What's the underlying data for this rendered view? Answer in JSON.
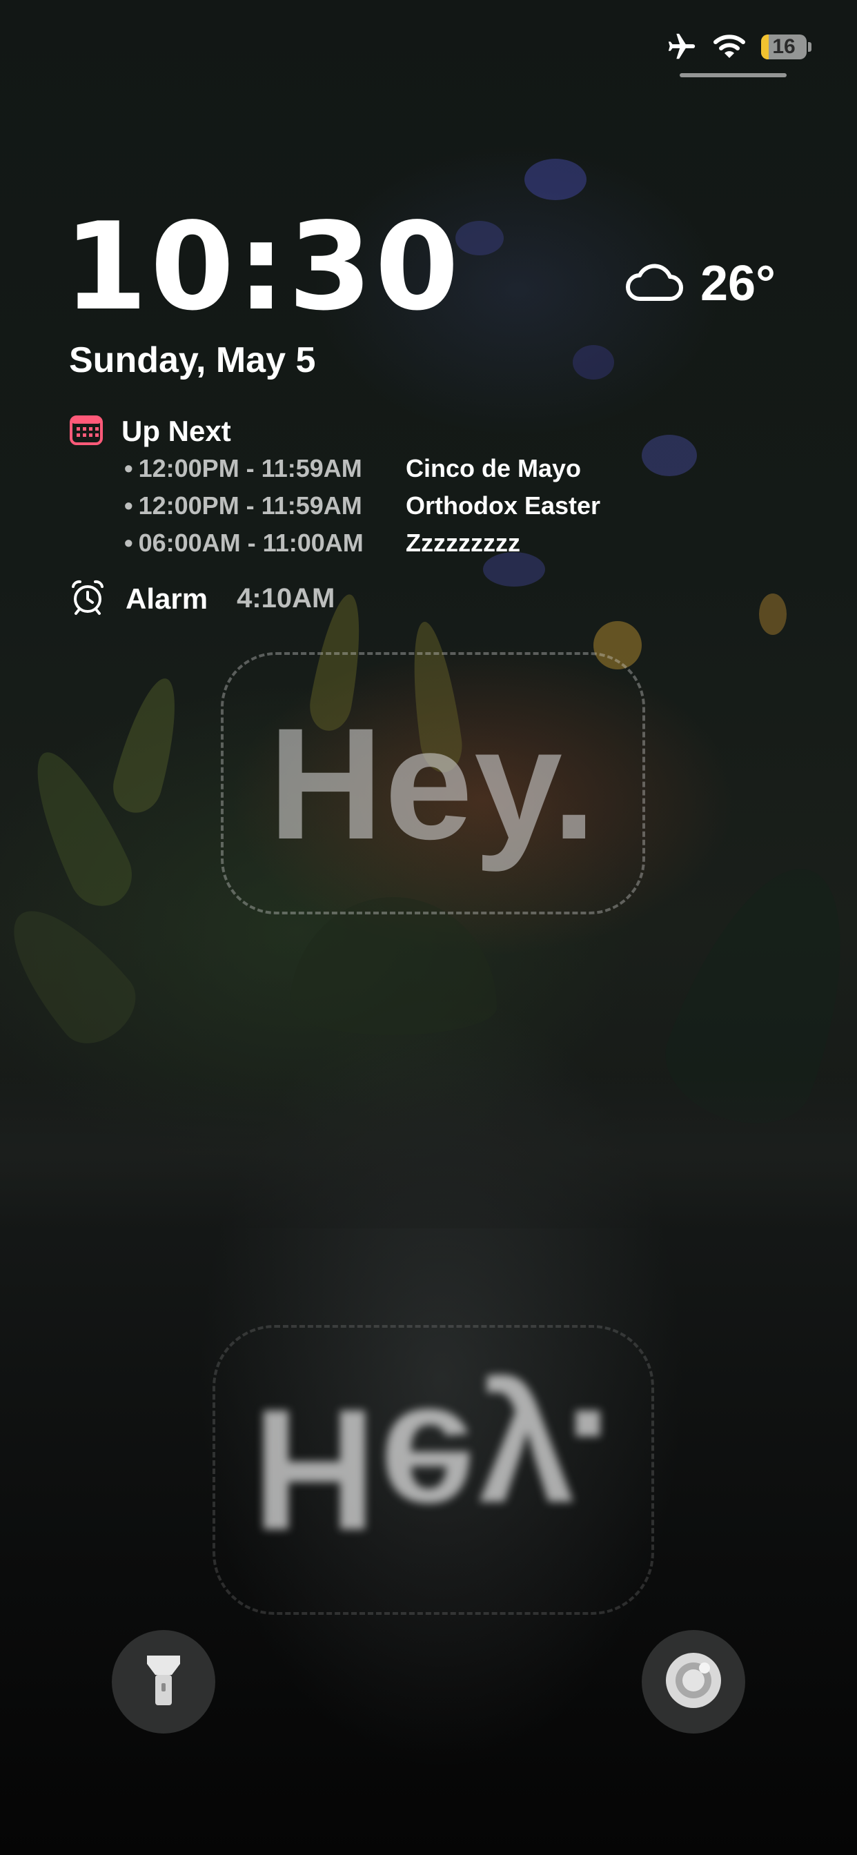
{
  "status_bar": {
    "airplane_icon": "airplane-icon",
    "wifi_icon": "wifi-icon",
    "battery": {
      "level": 16,
      "label": "16",
      "color": "#f2c230"
    }
  },
  "lock_screen": {
    "time": "10:30",
    "date": "Sunday, May 5",
    "weather": {
      "icon": "cloud-icon",
      "temperature": "26°"
    },
    "up_next": {
      "icon": "calendar-icon",
      "title": "Up Next",
      "events": [
        {
          "time": "12:00PM - 11:59AM",
          "name": "Cinco de Mayo"
        },
        {
          "time": "12:00PM - 11:59AM",
          "name": "Orthodox Easter"
        },
        {
          "time": "06:00AM - 11:00AM",
          "name": "Zzzzzzzzz"
        }
      ]
    },
    "alarm": {
      "icon": "alarm-clock-icon",
      "label": "Alarm",
      "time": "4:10AM"
    }
  },
  "wallpaper": {
    "sign_text": "Hey.",
    "reflection_text": "Hey."
  },
  "quick_actions": {
    "flashlight": "flashlight-icon",
    "camera": "camera-icon"
  }
}
